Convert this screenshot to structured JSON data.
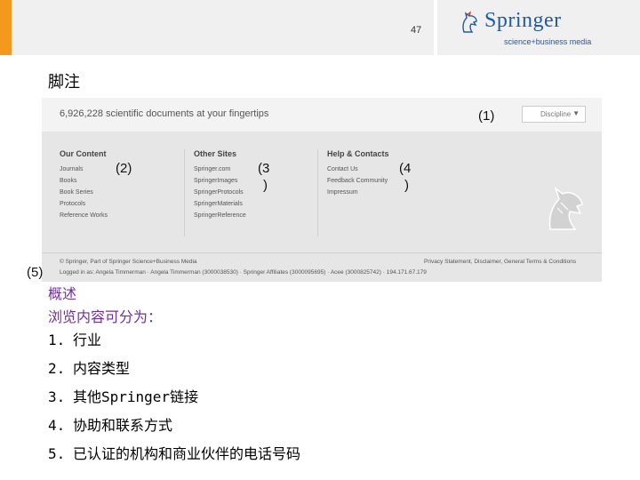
{
  "slide": {
    "page_number": "47",
    "section_title": "脚注",
    "accent_color": "#f39a1e",
    "brand_color": "#1f5aa6"
  },
  "logo": {
    "name": "Springer",
    "tagline": "science+business media"
  },
  "screenshot": {
    "doc_count": "6,926,228 scientific documents at your fingertips",
    "select_value": "Discipline",
    "columns": [
      {
        "heading": "Our Content",
        "items": [
          "Journals",
          "Books",
          "Book Series",
          "Protocols",
          "Reference Works"
        ]
      },
      {
        "heading": "Other Sites",
        "items": [
          "Springer.com",
          "SpringerImages",
          "SpringerProtocols",
          "SpringerMaterials",
          "SpringerReference"
        ]
      },
      {
        "heading": "Help & Contacts",
        "items": [
          "Contact Us",
          "Feedback Community",
          "Impressum"
        ]
      }
    ],
    "footer_copyright": "© Springer, Part of Springer Science+Business Media",
    "footer_links": "Privacy Statement, Disclaimer, General Terms & Conditions",
    "footer_logged_in": "Logged in as: Angela Timmerman · Angela Timmerman (3000038530) · Springer Affiliates (3000095695) · Acee (3000825742) · 194.171.67.179"
  },
  "markers": {
    "m1": "(1)",
    "m2": "(2)",
    "m3_line1": "(3",
    "m3_line2": ")",
    "m4_line1": "(4",
    "m4_line2": ")",
    "m5": "(5)"
  },
  "overview": {
    "title": "概述",
    "subtitle": "浏览内容可分为："
  },
  "list": [
    {
      "num": "1.",
      "text": "行业"
    },
    {
      "num": "2.",
      "text": "内容类型"
    },
    {
      "num": "3.",
      "text": "其他Springer链接"
    },
    {
      "num": "4.",
      "text": "协助和联系方式"
    },
    {
      "num": "5.",
      "text": "已认证的机构和商业伙伴的电话号码"
    }
  ]
}
